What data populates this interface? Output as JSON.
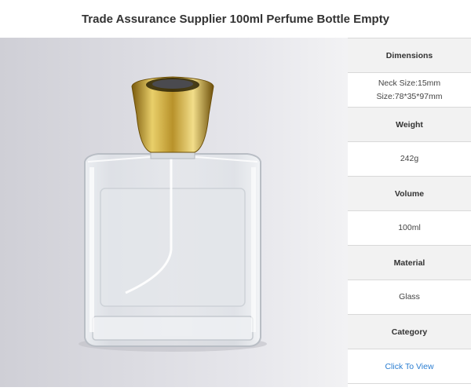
{
  "page": {
    "title": "Trade Assurance Supplier 100ml Perfume Bottle Empty"
  },
  "specs": [
    {
      "label": "Dimensions",
      "values": [
        "Neck Size:15mm",
        "Size:78*35*97mm"
      ]
    },
    {
      "label": "Weight",
      "values": [
        "242g"
      ]
    },
    {
      "label": "Volume",
      "values": [
        "100ml"
      ]
    },
    {
      "label": "Material",
      "values": [
        "Glass"
      ]
    },
    {
      "label": "Category",
      "link": "Click To View"
    }
  ],
  "colors": {
    "link": "#2a7dd1",
    "header_bg": "#f2f2f2",
    "border": "#d9d9d9"
  }
}
